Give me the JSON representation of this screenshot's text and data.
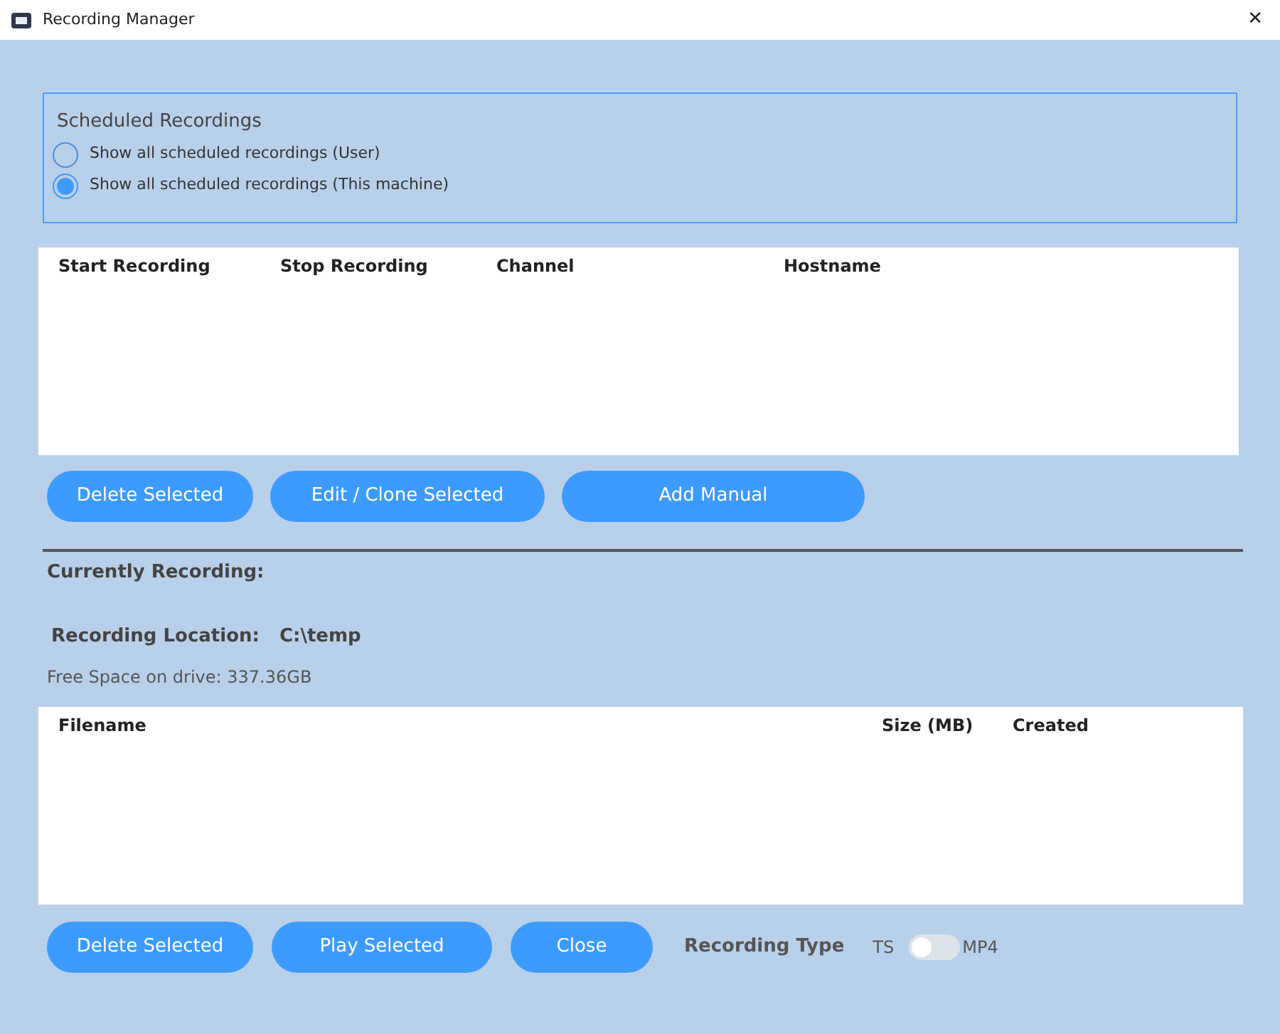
{
  "window": {
    "title": "Recording Manager",
    "close": "✕"
  },
  "scheduled": {
    "title": "Scheduled Recordings",
    "options": [
      {
        "label": "Show all scheduled recordings (User)",
        "selected": false
      },
      {
        "label": "Show all scheduled recordings (This machine)",
        "selected": true
      }
    ]
  },
  "scheduled_table": {
    "columns": [
      "Start Recording",
      "Stop Recording",
      "Channel",
      "Hostname"
    ]
  },
  "scheduled_buttons": [
    "Delete Selected",
    "Edit / Clone Selected",
    "Add Manual"
  ],
  "current": {
    "label": "Currently Recording:"
  },
  "location": {
    "label": "Recording Location:",
    "value": "C:\\temp"
  },
  "free_space": "Free Space on drive: 337.36GB",
  "files_table": {
    "columns": [
      "Filename",
      "Size (MB)",
      "Created"
    ]
  },
  "file_buttons": [
    "Delete Selected",
    "Play Selected",
    "Close"
  ],
  "recording_type": {
    "label": "Recording Type",
    "off_label": "TS",
    "on_label": "MP4",
    "on": false
  }
}
